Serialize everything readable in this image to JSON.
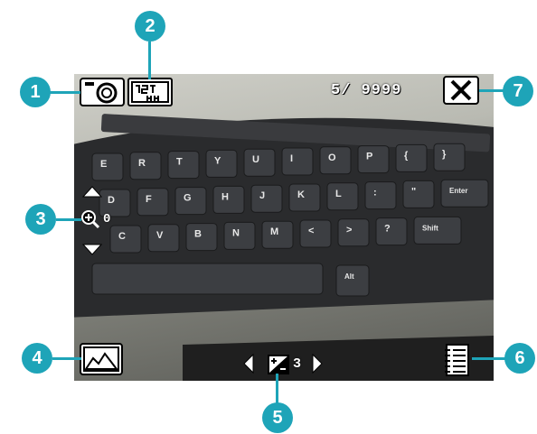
{
  "screen": {
    "photo_counter": "5/ 9999",
    "exposure_value": "3",
    "zoom_level": "0"
  },
  "callouts": [
    {
      "number": "1",
      "target": "capture-mode-icon"
    },
    {
      "number": "2",
      "target": "resolution-icon"
    },
    {
      "number": "3",
      "target": "zoom-control"
    },
    {
      "number": "4",
      "target": "album-icon"
    },
    {
      "number": "5",
      "target": "exposure-control"
    },
    {
      "number": "6",
      "target": "menu-icon"
    },
    {
      "number": "7",
      "target": "close-icon"
    }
  ],
  "keyboard": {
    "row1": [
      "E",
      "R",
      "T",
      "Y",
      "U",
      "I",
      "O",
      "P",
      "{",
      "}"
    ],
    "row2": [
      "D",
      "F",
      "G",
      "H",
      "J",
      "K",
      "L",
      ":",
      "\"",
      "Enter"
    ],
    "row3": [
      "C",
      "V",
      "B",
      "N",
      "M",
      "<",
      ">",
      "?",
      "Shift"
    ],
    "row4": [
      "Alt"
    ]
  },
  "colors": {
    "accent": "#1ea4b8",
    "hud": "#ffffff"
  }
}
